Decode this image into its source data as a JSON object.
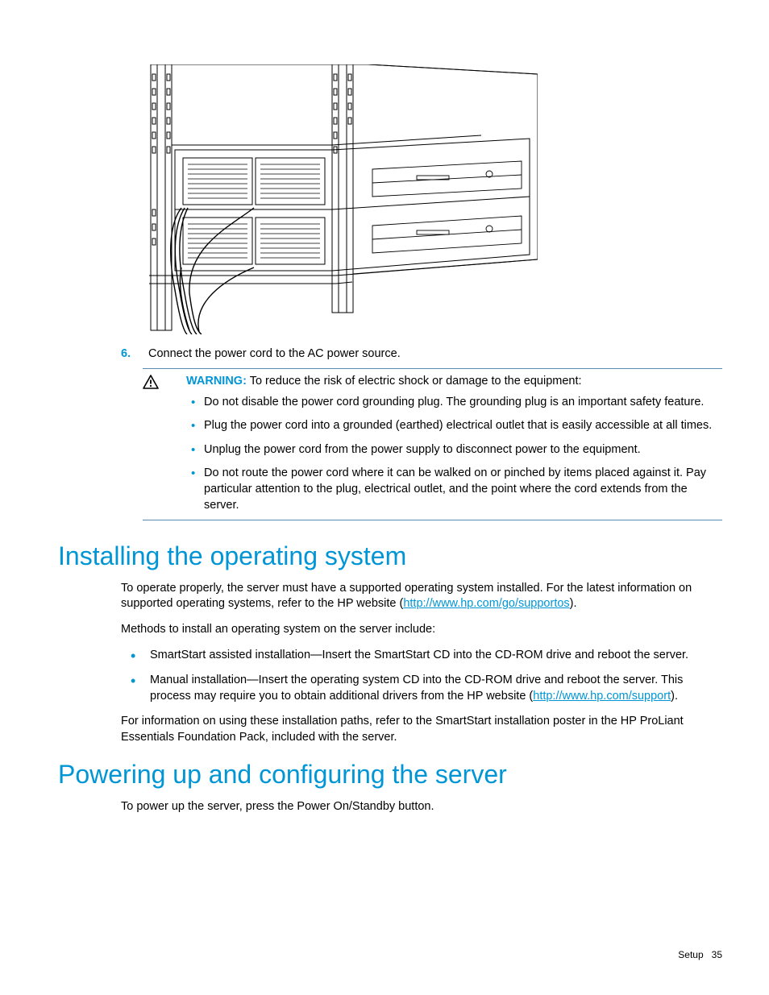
{
  "step": {
    "num": "6.",
    "text": "Connect the power cord to the AC power source."
  },
  "warning": {
    "label": "WARNING:",
    "intro": "  To reduce the risk of electric shock or damage to the equipment:",
    "bullets": [
      "Do not disable the power cord grounding plug. The grounding plug is an important safety feature.",
      "Plug the power cord into a grounded (earthed) electrical outlet that is easily accessible at all times.",
      "Unplug the power cord from the power supply to disconnect power to the equipment.",
      "Do not route the power cord where it can be walked on or pinched by items placed against it. Pay particular attention to the plug, electrical outlet, and the point where the cord extends from the server."
    ]
  },
  "install": {
    "heading": "Installing the operating system",
    "p1_a": "To operate properly, the server must have a supported operating system installed. For the latest information on supported operating systems, refer to the HP website (",
    "p1_link": "http://www.hp.com/go/supportos",
    "p1_b": ").",
    "p2": "Methods to install an operating system on the server include:",
    "bullets": {
      "b1": "SmartStart assisted installation—Insert the SmartStart CD into the CD-ROM drive and reboot the server.",
      "b2_a": "Manual installation—Insert the operating system CD into the CD-ROM drive and reboot the server. This process may require you to obtain additional drivers from the HP website (",
      "b2_link": "http://www.hp.com/support",
      "b2_b": ")."
    },
    "p3": "For information on using these installation paths, refer to the SmartStart installation poster in the HP ProLiant Essentials Foundation Pack, included with the server."
  },
  "power": {
    "heading": "Powering up and configuring the server",
    "p1": "To power up the server, press the Power On/Standby button."
  },
  "footer": {
    "section": "Setup",
    "page": "35"
  }
}
